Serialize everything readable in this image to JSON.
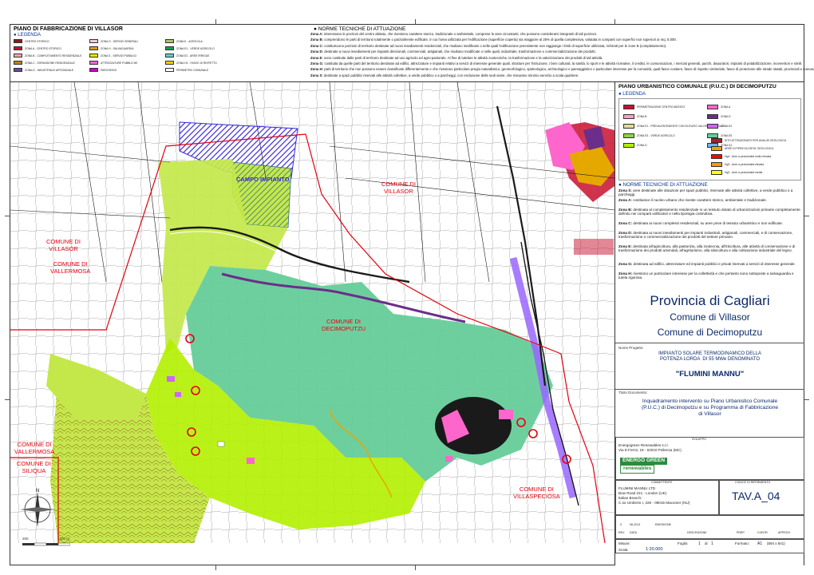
{
  "top_legend": {
    "title": "PIANO DI FABBRICAZIONE DI VILLASOR",
    "legend_label": "● LEGENDA",
    "items": [
      {
        "color": "#8b1a1a",
        "label": "CENTRO STORICO"
      },
      {
        "color": "#c8102e",
        "label": "ZONA A - CENTRO STORICO"
      },
      {
        "color": "#f4a6a6",
        "label": "ZONA B - COMPLETAMENTO RESIDENZIALE"
      },
      {
        "color": "#b8860b",
        "label": "ZONA C - ESPANSIONE RESIDENZIALE"
      },
      {
        "color": "#6b4c9a",
        "label": "ZONA D - INDUSTRIALE ARTIGIANALE"
      },
      {
        "color": "#f7c6e0",
        "label": "ZONA G - SERVIZI GENERALI"
      },
      {
        "color": "#d4a017",
        "label": "ZONA H - SALVAGUARDIA"
      },
      {
        "color": "#e6e600",
        "label": "ZONA S - SERVIZI PUBBLICI"
      },
      {
        "color": "#ff66cc",
        "label": "ATTREZZATURE PUBBLICHE"
      },
      {
        "color": "#cc00cc",
        "label": "PARCHEGGI"
      },
      {
        "color": "#a3c86a",
        "label": "ZONA E - AGRICOLA"
      },
      {
        "color": "#00a651",
        "label": "ZONA E1 - VERDE AGRICOLO"
      },
      {
        "color": "#66cccc",
        "label": "ZONA E2 - AREE IRRIGUE"
      },
      {
        "color": "#ffcc00",
        "label": "ZONA H1 - FASCE DI RISPETTO"
      },
      {
        "color": "#ffffff",
        "label": "PERIMETRO COMUNALE"
      }
    ],
    "norm_title": "● NORME TECNICHE DI ATTUAZIONE",
    "norm_lines": [
      {
        "zone": "Zona A:",
        "text": "interessano le porzioni del centro abitato, che rivestono carattere storico, tradizionale o ambientale, comprese le aree circostanti, che possono considerarsi integranti di tali porzioni."
      },
      {
        "zone": "Zona B:",
        "text": "comprendono le parti di territorio totalmente o parzialmente edificate, in cui l'area utilizzata per l'edificazione (superficie coperta) sia maggiore al 25% di quella complessiva, valutata in comparti con superfici non superiori ai mq. 5.000."
      },
      {
        "zone": "Zona C:",
        "text": "costituiscono porzioni di territorio destinate ad nuovi insediamenti residenziali, che risultano inedificate o nelle quali l'edificazione preesistente non raggiunge i limiti di superficie utilizzata, richiesti per le zone B (completamento)."
      },
      {
        "zone": "Zona D:",
        "text": "destinate a nuovi insediamenti per impianti direzionali, commerciali, artigianali, che risultano modificate o nelle quali, industriale, trasformazione e commercializzazione dei prodotti."
      },
      {
        "zone": "Zona E:",
        "text": "sono costituite dalle parti di territorio destinate ad uso agricolo ed agro-pastorale. Al fine di tutelare le attività zootecniche, la trasformazione e la valorizzazione dei prodotti di tali attività."
      },
      {
        "zone": "Zona G:",
        "text": "costituita da quelle parti del territorio destinate ad edifici, attrezzature e impianti relativi a servizi di interesse generale quali, strutture per l'istruzione, i beni culturali, la sanità, lo sport e le attività ricreative, il credito, le comunicazioni, i mercati generali, parchi, depuratori, impianti di potabilizzazione, inceneritori e simili."
      },
      {
        "zone": "Zona H:",
        "text": "parti di territorio che non possono essere classificate differentemente e che rivestono particolare pregio naturalistico, geomorfologico, speleologico, archeologico e paesaggistico o particolare interesse per la comunità, quali fasce costiere, fasce di rispetto cimiteriale, fasce di protezione alle strade statali, provinciali e comunali."
      },
      {
        "zone": "Zona S:",
        "text": "destinate a spazi pubblici riservati alle attività collettive, a verde pubblico o a parcheggi, con esclusione delle sedi viarie, che misurano minimo servizio a scala quartiere."
      }
    ]
  },
  "map": {
    "labels": [
      {
        "text": "CAMPO IMPIANTO",
        "kind": "zone"
      },
      {
        "text": "COMUNE DI\nVILLASOR",
        "kind": "comune"
      },
      {
        "text": "COMUNE DI\nVILLASOR",
        "kind": "comune"
      },
      {
        "text": "COMUNE DI\nVALLERMOSA",
        "kind": "comune"
      },
      {
        "text": "COMUNE DI\nDECIMOPUTZU",
        "kind": "comune"
      },
      {
        "text": "COMUNE DI\nVALLERMOSA",
        "kind": "comune"
      },
      {
        "text": "COMUNE DI\nSILIQUA",
        "kind": "comune"
      },
      {
        "text": "COMUNE DI\nVILLASPECIOSA",
        "kind": "comune"
      }
    ],
    "scale_bar": {
      "left": "200",
      "right": "1000 m"
    }
  },
  "right_panel": {
    "title": "PIANO URBANISTICO COMUNALE (P.U.C.) DI DECIMOPUTZU",
    "legend_label": "● LEGENDA",
    "legend_items": [
      {
        "color": "#c8102e",
        "label": "PERIMETRAZIONE CENTRO ABITATO"
      },
      {
        "color": "#ff66cc",
        "label": "ZONA A"
      },
      {
        "color": "#f7a1c4",
        "label": "ZONA B"
      },
      {
        "color": "#6b2e8a",
        "label": "ZONA D"
      },
      {
        "color": "#dcdc9a",
        "label": "ZONA E1 - PREVALENTEMENTE CON ELEVATO VALORE AGRICOLO"
      },
      {
        "color": "#cc66ff",
        "label": "ZONA E2"
      },
      {
        "color": "#8fd14f",
        "label": "ZONA E3 - VERDE AGRICOLO"
      },
      {
        "color": "#66cc99",
        "label": "ZONA E5"
      },
      {
        "color": "#b2f000",
        "label": "ZONA G"
      },
      {
        "color": "#6fb3ff",
        "label": "ZONA S1"
      },
      {
        "color": "#c8102e",
        "label": "SITO ATTENZIONATO PER ANALISI GEOLOGICA"
      },
      {
        "color": "#e5a800",
        "label": "AREE DI PERICOLOSITA' GEOLOGICA"
      },
      {
        "color": "#ff0000",
        "label": "Hg4 - Aree a pericolosità molto elevata"
      },
      {
        "color": "#ff9900",
        "label": "Hg3 - Aree a pericolosità elevata"
      },
      {
        "color": "#ffff00",
        "label": "Hg2 - Aree a pericolosità media"
      }
    ],
    "norm_title": "● NORME TECNICHE DI ATTUAZIONE",
    "norm_lines": [
      {
        "zone": "Zona S:",
        "text": "aree destinate alle dotazioni per spazi pubblici, riservate alle attività collettive, a verde pubblico o a parcheggi."
      },
      {
        "zone": "Zona A:",
        "text": "costituisce il nucleo urbano che riveste carattere storico, ambientale e tradizionale."
      },
      {
        "zone": "Zona B:",
        "text": "destinata al completamento residenziale in un tessuto dotato di urbanizzazioni primarie completamente definito nei comparti edificatori e nella tipologia costruttiva."
      },
      {
        "zone": "Zona C:",
        "text": "destinata ai nuovi complessi residenziali, su aree prive di tessuto urbanistico e non edificate."
      },
      {
        "zone": "Zona D:",
        "text": "destinata ai nuovi insediamenti per impianti industriali, artigianali, commerciali, e di conservazione, trasformazione o commercializzazione dei prodotti del settore primario."
      },
      {
        "zone": "Zona E:",
        "text": "destinata all'agricoltura, alla pastorizia, alla zootecnia, all'itticoltura, alle attività di conservazione e di trasformazione dei prodotti aziendali, all'agriturismo, alla silvicoltura e alla coltivazione industriale del legno."
      },
      {
        "zone": "Zona G:",
        "text": "destinata ad edifici, attrezzature ed impianti pubblici e privati riservati a servizi di interesse generale."
      },
      {
        "zone": "Zona H:",
        "text": "rivestono un particolare interesse per la collettività e che pertanto sono sottoposte a salvaguardia e tutela rigorosa."
      }
    ],
    "province": "Provincia di Cagliari",
    "comune1": "Comune di Villasor",
    "comune2": "Comune di Decimoputzu",
    "project_label": "Nome Progetto:",
    "project_desc": "IMPIANTO SOLARE TERMODINAMICO DELLA\nPOTENZA LORDA  DI 55 MWe DENOMINATO",
    "project_name": "\"FLUMINI MANNU\"",
    "doc_label": "Titolo Documento:",
    "doc_title": "Inquadramento intervento su Piano Urbanistico Comunale\n(P.U.C.) di Decimoputzu e su Programma di Fabbricazione\ndi Villasor",
    "developer_label": "SVILUPPO",
    "developer_name": "Energogreen Renewables s.r.l.",
    "developer_addr": "Via E.Fermi, 19 - 62010 Pollenza (MC)",
    "client_label": "COMMITTENTE",
    "client_name": "FLUMINI MANNU LTD",
    "client_addr1": "Bow Road 221 - London (UK)",
    "client_addr2": "Italian Branch:",
    "client_addr3": "C.so Umberto I, 226 - 09015 Macomer (NU)",
    "logo_line1": "ENERGO GREEN",
    "logo_line2": "renewables",
    "tav_label": "CODICE DI RIFERIMENTO",
    "tav_code": "TAV.A_04",
    "rev_num": "0",
    "rev_date": "06-2013",
    "rev_desc": "EMISSIONE",
    "rev_headers": [
      "REV.",
      "DATA",
      "DESCRIZIONE",
      "PREP.",
      "CONTR.",
      "APPROV."
    ],
    "scale_label": "Scala:",
    "scale_value": "1:20.000",
    "sheet_label": "Foglio:",
    "sheet_value": "1",
    "sheet_of": "di",
    "sheet_total": "1",
    "format_label": "Formato:",
    "format_value": "A1",
    "format_dims": "(594 x 841)",
    "measure_label": "Misure:"
  },
  "colors": {
    "green_E5": "#66cc99",
    "yellow_green": "#c4e84a",
    "lime": "#b2f000",
    "urban_black": "#1a1a1a",
    "urban_pink": "#ff66cc",
    "purple_hatch": "#3a2ad8",
    "boundary_red": "#e3000f",
    "text_blue": "#0a2a6a"
  }
}
